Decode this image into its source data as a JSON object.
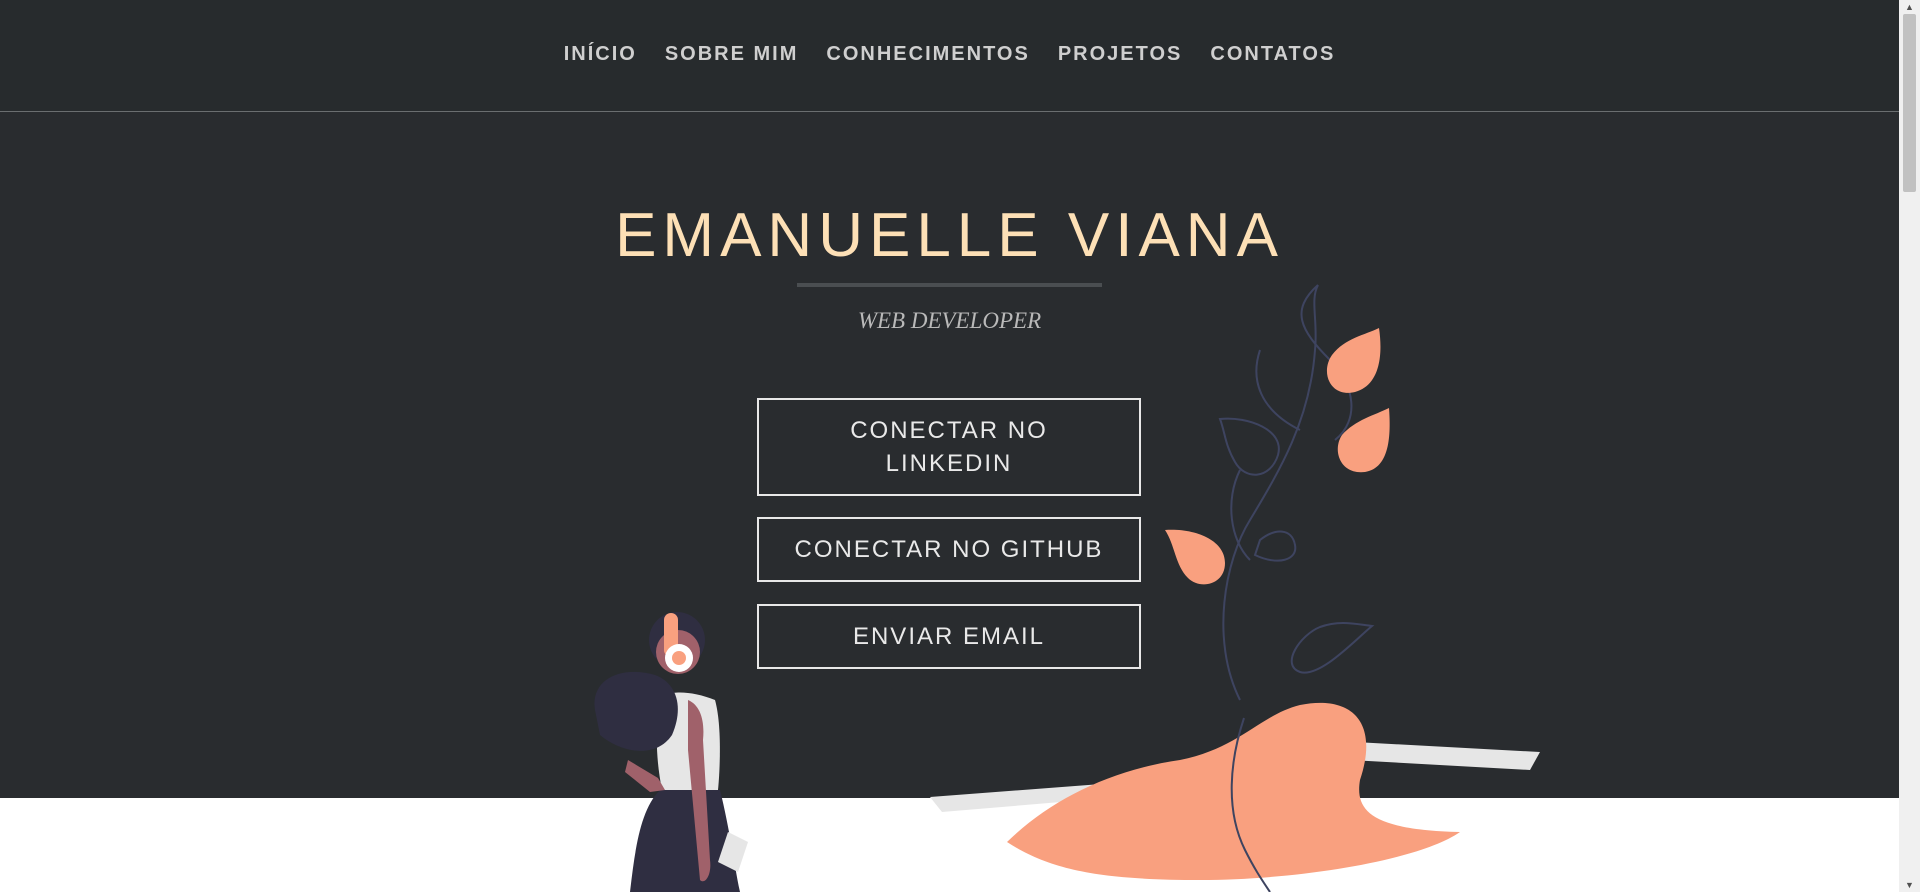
{
  "nav": {
    "items": [
      {
        "label": "INÍCIO"
      },
      {
        "label": "SOBRE MIM"
      },
      {
        "label": "CONHECIMENTOS"
      },
      {
        "label": "PROJETOS"
      },
      {
        "label": "CONTATOS"
      }
    ]
  },
  "hero": {
    "name": "EMANUELLE VIANA",
    "role": "WEB DEVELOPER",
    "buttons": {
      "linkedin": "CONECTAR NO LINKEDIN",
      "github": "CONECTAR NO GITHUB",
      "email": "ENVIAR EMAIL"
    }
  },
  "colors": {
    "header_bg": "#272b2d",
    "hero_bg": "#292c2f",
    "title": "#fde0b6",
    "accent": "#f9a07f"
  },
  "icons": {
    "scroll_up": "triangle-up-icon",
    "scroll_down": "triangle-down-icon"
  }
}
